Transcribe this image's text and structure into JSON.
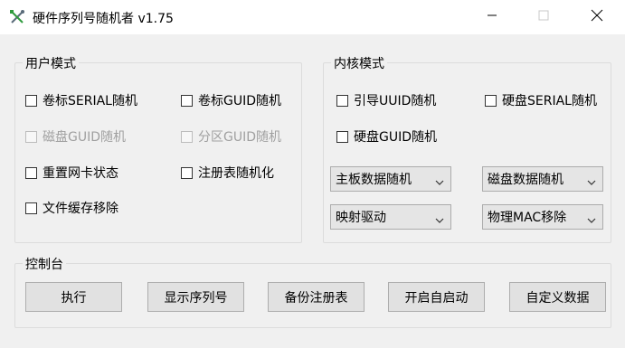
{
  "window": {
    "title": "硬件序列号随机者 v1.75",
    "icon": "crossed-tools-icon",
    "controls": [
      "minimize-icon",
      "maximize-icon",
      "close-icon"
    ]
  },
  "user_mode": {
    "title": "用户模式",
    "options": [
      {
        "label": "卷标SERIAL随机",
        "checked": false,
        "enabled": true
      },
      {
        "label": "卷标GUID随机",
        "checked": false,
        "enabled": true
      },
      {
        "label": "磁盘GUID随机",
        "checked": false,
        "enabled": false
      },
      {
        "label": "分区GUID随机",
        "checked": false,
        "enabled": false
      },
      {
        "label": "重置网卡状态",
        "checked": false,
        "enabled": true
      },
      {
        "label": "注册表随机化",
        "checked": false,
        "enabled": true
      },
      {
        "label": "文件缓存移除",
        "checked": false,
        "enabled": true
      }
    ]
  },
  "kernel_mode": {
    "title": "内核模式",
    "options": [
      {
        "label": "引导UUID随机",
        "checked": false,
        "enabled": true
      },
      {
        "label": "硬盘SERIAL随机",
        "checked": false,
        "enabled": true
      },
      {
        "label": "硬盘GUID随机",
        "checked": false,
        "enabled": true
      }
    ],
    "combos": [
      {
        "value": "主板数据随机"
      },
      {
        "value": "磁盘数据随机"
      },
      {
        "value": "映射驱动"
      },
      {
        "value": "物理MAC移除"
      }
    ]
  },
  "console": {
    "title": "控制台",
    "buttons": [
      "执行",
      "显示序列号",
      "备份注册表",
      "开启自启动",
      "自定义数据"
    ]
  }
}
